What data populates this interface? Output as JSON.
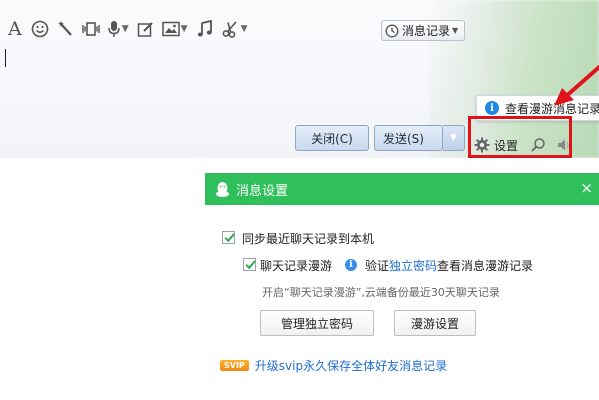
{
  "chat": {
    "history_label": "消息记录",
    "close_label": "关闭(C)",
    "send_label": "发送(S)",
    "settings_label": "设置",
    "tooltip_text": "查看漫游消息记录"
  },
  "toolbar": {
    "font_glyph": "A",
    "emoji_glyph": "☺"
  },
  "panel": {
    "title": "消息设置",
    "close_glyph": "×",
    "sync_label": "同步最近聊天记录到本机",
    "roaming_label": "聊天记录漫游",
    "verify_prefix": "验证",
    "verify_link": "独立密码",
    "verify_suffix": "查看消息漫游记录",
    "hint": "开启“聊天记录漫游”,云端备份最近30天聊天记录",
    "manage_password_btn": "管理独立密码",
    "roaming_settings_btn": "漫游设置",
    "svip_badge": "SVIP",
    "svip_link": "升级svip永久保存全体好友消息记录"
  },
  "colors": {
    "header_green": "#2fbf5b",
    "highlight_red": "#e0121a",
    "link_blue": "#1d6fd0"
  },
  "icons": [
    "font-icon",
    "emoji-icon",
    "magic-wand-icon",
    "screen-shake-icon",
    "microphone-icon",
    "edit-icon",
    "image-icon",
    "music-icon",
    "scissors-icon",
    "clock-icon",
    "info-icon",
    "gear-icon",
    "search-icon",
    "speaker-icon",
    "penguin-icon",
    "close-icon",
    "checkbox-icon"
  ]
}
